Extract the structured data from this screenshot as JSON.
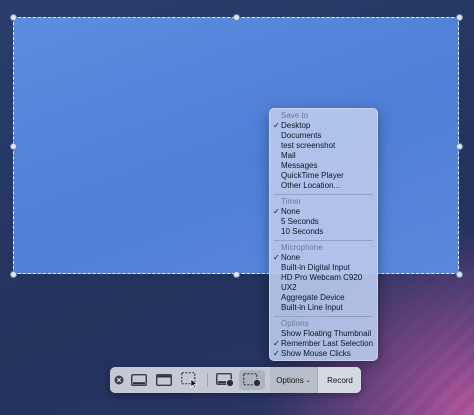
{
  "menu": {
    "sections": [
      {
        "header": "Save to",
        "items": [
          {
            "label": "Desktop",
            "checked": true
          },
          {
            "label": "Documents",
            "checked": false
          },
          {
            "label": "test screenshot",
            "checked": false
          },
          {
            "label": "Mail",
            "checked": false
          },
          {
            "label": "Messages",
            "checked": false
          },
          {
            "label": "QuickTime Player",
            "checked": false
          },
          {
            "label": "Other Location...",
            "checked": false
          }
        ]
      },
      {
        "header": "Timer",
        "items": [
          {
            "label": "None",
            "checked": true
          },
          {
            "label": "5 Seconds",
            "checked": false
          },
          {
            "label": "10 Seconds",
            "checked": false
          }
        ]
      },
      {
        "header": "Microphone",
        "items": [
          {
            "label": "None",
            "checked": true
          },
          {
            "label": "Built-in Digital Input",
            "checked": false
          },
          {
            "label": "HD Pro Webcam C920",
            "checked": false
          },
          {
            "label": "UX2",
            "checked": false
          },
          {
            "label": "Aggregate Device",
            "checked": false
          },
          {
            "label": "Built-in Line Input",
            "checked": false
          }
        ]
      },
      {
        "header": "Options",
        "items": [
          {
            "label": "Show Floating Thumbnail",
            "checked": false
          },
          {
            "label": "Remember Last Selection",
            "checked": true
          },
          {
            "label": "Show Mouse Clicks",
            "checked": true
          }
        ]
      }
    ],
    "check_glyph": "✓"
  },
  "toolbar": {
    "tools": [
      {
        "name": "close-icon"
      },
      {
        "name": "capture-screen-icon"
      },
      {
        "name": "capture-window-icon"
      },
      {
        "name": "capture-selection-icon"
      },
      {
        "name": "record-screen-icon"
      },
      {
        "name": "record-selection-icon"
      }
    ],
    "options_label": "Options",
    "record_label": "Record"
  }
}
